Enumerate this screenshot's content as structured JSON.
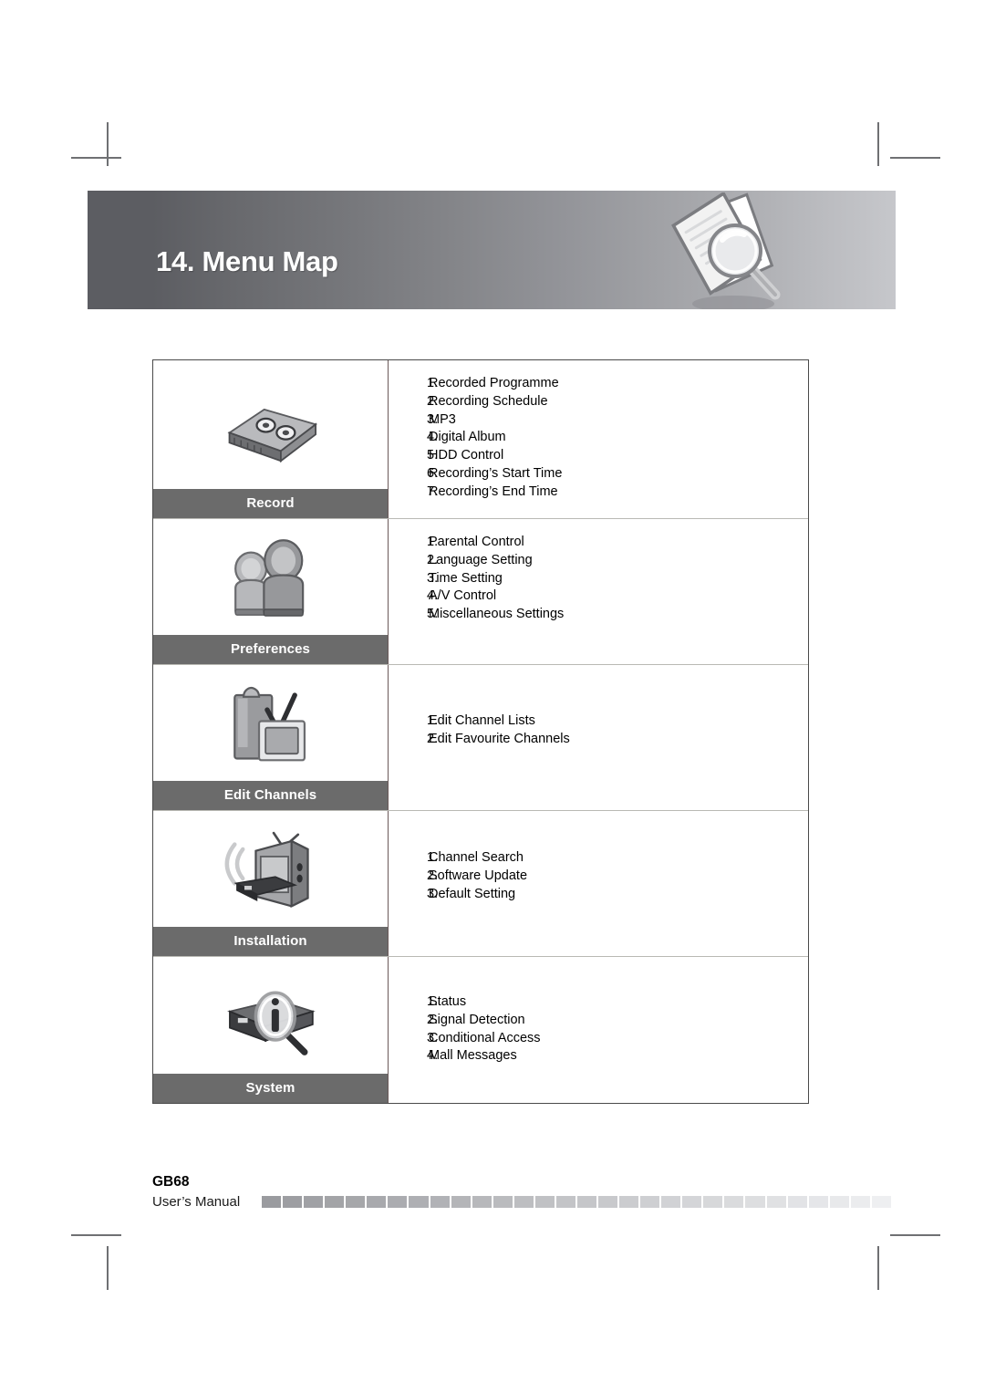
{
  "document": {
    "chapter_number": "14.",
    "chapter_title": "Menu Map",
    "banner_title": "14. Menu Map",
    "banner_icon": "documents-magnifier-icon",
    "accent_dark": "#5c5d62",
    "accent_light": "#c6c7cb",
    "label_bar_color": "#6b6b6b"
  },
  "menu_map": {
    "sections": [
      {
        "label": "Record",
        "icon": "hdd-recorder-icon",
        "items": [
          {
            "num": "1.",
            "text": "Recorded Programme"
          },
          {
            "num": "2.",
            "text": "Recording Schedule"
          },
          {
            "num": "3.",
            "text": "MP3"
          },
          {
            "num": "4.",
            "text": "Digital Album"
          },
          {
            "num": "5.",
            "text": "HDD Control"
          },
          {
            "num": "6.",
            "text": "Recording’s Start Time"
          },
          {
            "num": "7.",
            "text": "Recording’s End Time"
          }
        ]
      },
      {
        "label": "Preferences",
        "icon": "two-people-icon",
        "items": [
          {
            "num": "1.",
            "text": "Parental Control"
          },
          {
            "num": "2.",
            "text": "Language Setting"
          },
          {
            "num": "3.",
            "text": "Time Setting"
          },
          {
            "num": "4.",
            "text": "A/V Control"
          },
          {
            "num": "5.",
            "text": "Miscellaneous Settings"
          }
        ]
      },
      {
        "label": "Edit Channels",
        "icon": "clipboard-checkmark-tv-icon",
        "items": [
          {
            "num": "1.",
            "text": "Edit Channel Lists"
          },
          {
            "num": "2.",
            "text": "Edit Favourite Channels"
          }
        ]
      },
      {
        "label": "Installation",
        "icon": "tv-antenna-receiver-icon",
        "items": [
          {
            "num": "1.",
            "text": "Channel Search"
          },
          {
            "num": "2.",
            "text": "Software Update"
          },
          {
            "num": "3.",
            "text": "Default Setting"
          }
        ]
      },
      {
        "label": "System",
        "icon": "receiver-info-magnifier-icon",
        "items": [
          {
            "num": "1.",
            "text": "Status"
          },
          {
            "num": "2.",
            "text": "Signal Detection"
          },
          {
            "num": "3.",
            "text": "Conditional Access"
          },
          {
            "num": "4.",
            "text": "Mall Messages"
          }
        ]
      }
    ]
  },
  "footer": {
    "page_label": "GB68",
    "manual_label": "User’s Manual"
  }
}
